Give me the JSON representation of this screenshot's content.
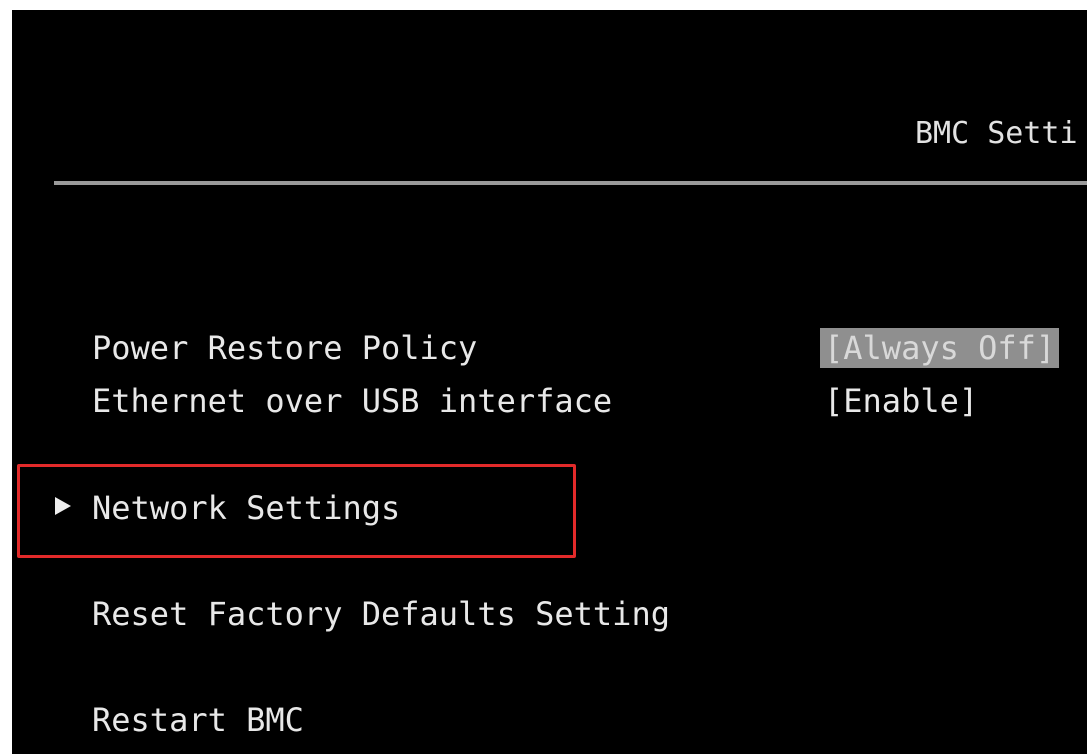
{
  "header": {
    "title": "BMC Setti"
  },
  "menu": {
    "items": [
      {
        "label": "Power Restore Policy",
        "value": "[Always Off]"
      },
      {
        "label": "Ethernet over USB interface",
        "value": "[Enable]"
      },
      {
        "label": "Network Settings"
      },
      {
        "label": "Reset Factory Defaults Setting"
      },
      {
        "label": "Restart BMC"
      }
    ]
  },
  "icons": {
    "submenu": "submenu-arrow-icon"
  },
  "colors": {
    "background": "#000000",
    "text": "#e8e8e8",
    "selected_value_bg": "#8f8f8f",
    "divider": "#9a9a9a",
    "highlight_border": "#e22a2a"
  }
}
